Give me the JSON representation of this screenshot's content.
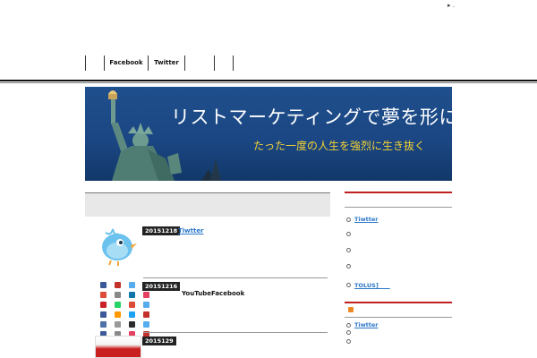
{
  "corner_mark": "▸ .",
  "nav": {
    "items": [
      {
        "label": ""
      },
      {
        "label": "Facebook"
      },
      {
        "label": "Twitter"
      },
      {
        "label": ""
      },
      {
        "label": ""
      }
    ]
  },
  "banner": {
    "title": "リストマーケティングで夢を形に",
    "subtitle": "たった一度の人生を強烈に生き抜く"
  },
  "posts": [
    {
      "date": "20151218",
      "title": "Tiwtter",
      "is_link": true,
      "thumb": "twitter-bird-icon"
    },
    {
      "date": "20151216",
      "title": "YouTubeFacebook",
      "is_link": false,
      "thumb": "social-icons-grid"
    },
    {
      "date": "2015129",
      "title": "",
      "is_link": false,
      "thumb": "ad-banner"
    }
  ],
  "sidebar": {
    "section1_items": [
      {
        "label": "Tiwtter",
        "is_link": true
      },
      {
        "label": "",
        "is_link": false
      },
      {
        "label": "",
        "is_link": false
      },
      {
        "label": "",
        "is_link": false
      },
      {
        "label": "TOLUS]　　",
        "is_link": true
      }
    ],
    "section2_items": [
      {
        "label": "Tiwtter",
        "is_link": true
      },
      {
        "label": "",
        "is_link": false
      },
      {
        "label": "",
        "is_link": false
      }
    ]
  },
  "colors": {
    "accent": "#c02020",
    "link": "#2a76c8",
    "banner_bg": "#1f4f8c",
    "banner_sub": "#f5d232"
  },
  "social_grid_colors": [
    "#3b5998",
    "#c4302b",
    "#55acee",
    "#3b5998",
    "#dd4b39",
    "#888888",
    "#0e76a8",
    "#e4405f",
    "#cb2027",
    "#25d366",
    "#dd4b39",
    "#55acee",
    "#3b5998",
    "#ff9900",
    "#1da1f2",
    "#c4302b",
    "#4e71a8",
    "#999999",
    "#2b2b2b",
    "#55acee",
    "#3b5998",
    "#888888",
    "#e4405f",
    "#c4302b"
  ]
}
